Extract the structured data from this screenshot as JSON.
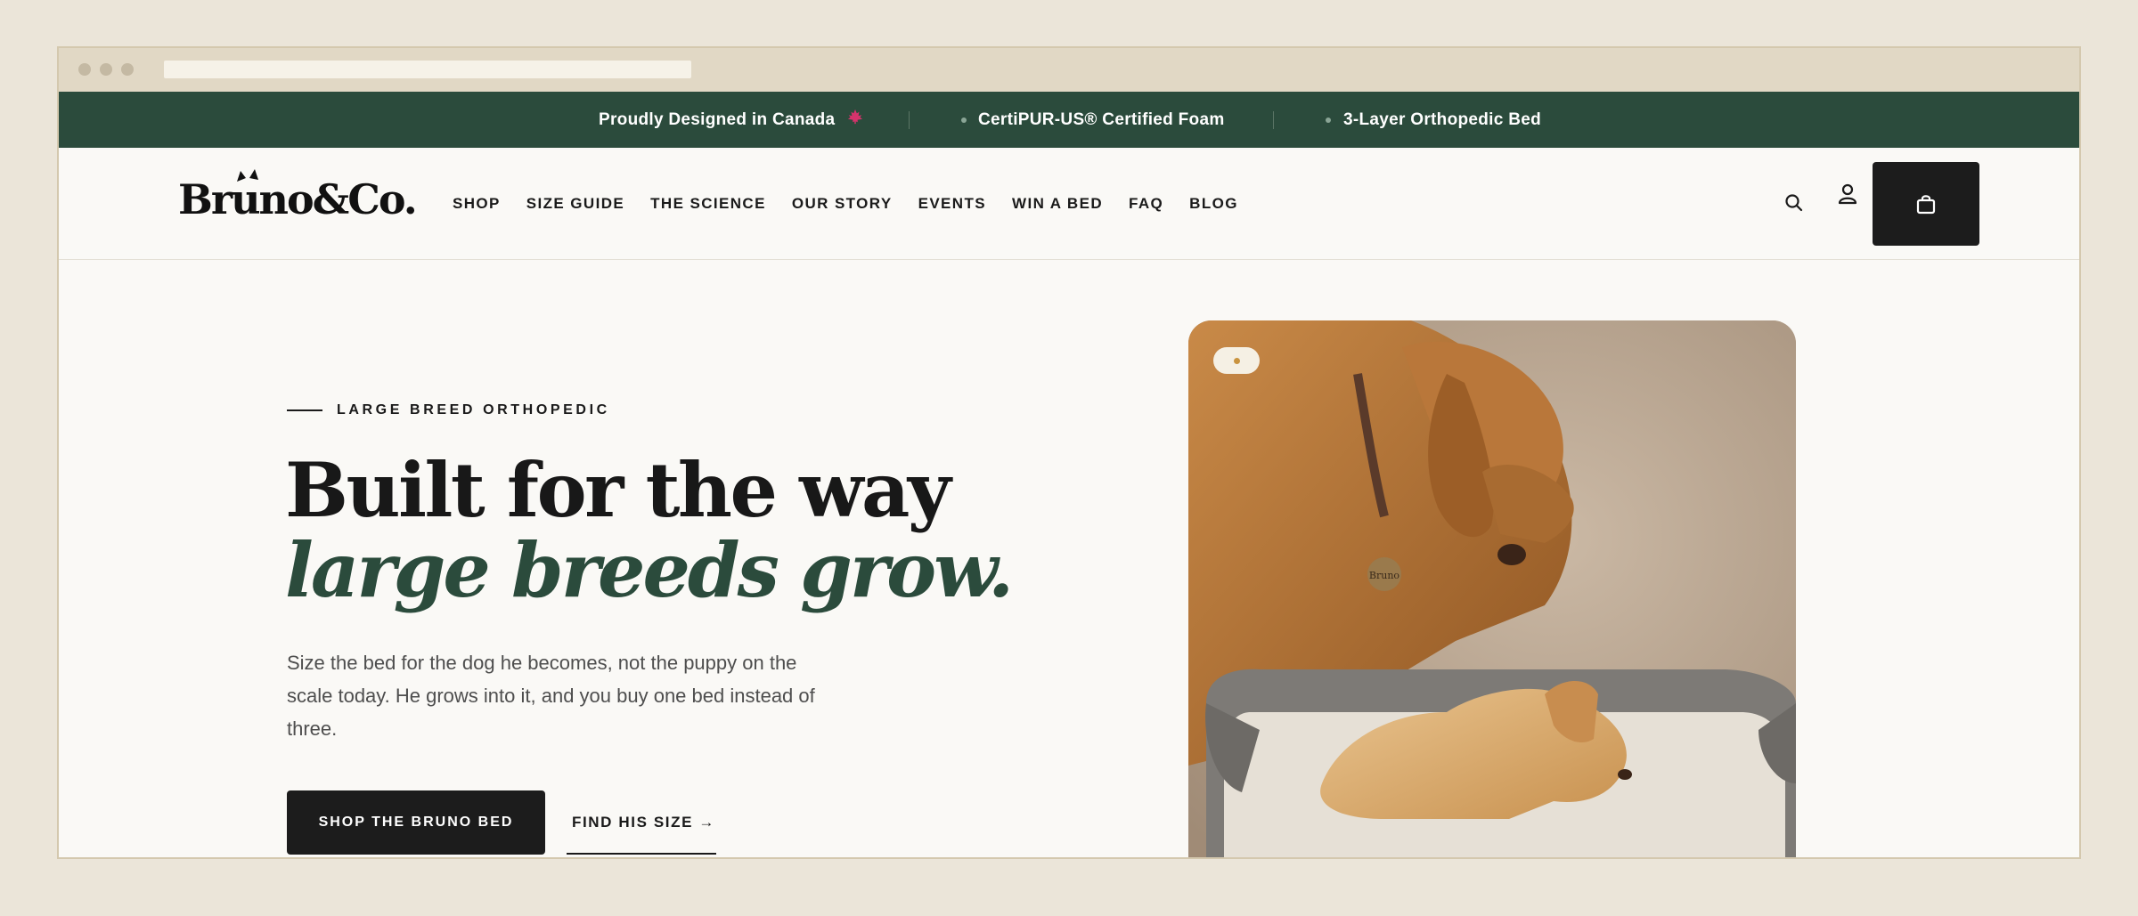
{
  "announcement": {
    "item1": "Proudly Designed in Canada",
    "item2": "CertiPUR-US® Certified Foam",
    "item3": "3-Layer Orthopedic Bed"
  },
  "header": {
    "logo": "Bruno&Co.",
    "nav": [
      "SHOP",
      "SIZE GUIDE",
      "THE SCIENCE",
      "OUR STORY",
      "EVENTS",
      "WIN A BED",
      "FAQ",
      "BLOG"
    ]
  },
  "hero": {
    "eyebrow": "LARGE BREED ORTHOPEDIC",
    "headline_line1": "Built for the way",
    "headline_line2": "large breeds grow.",
    "lead": "Size the bed for the dog he becomes, not the puppy on the scale today. He grows into it, and you buy one bed instead of three.",
    "cta_primary": "SHOP THE BRUNO BED",
    "cta_secondary": "FIND HIS SIZE →",
    "image_tag_text": "Bruno"
  },
  "colors": {
    "brand_green": "#2b4b3c",
    "dark": "#1c1c1c",
    "background": "#faf9f6",
    "maple_leaf": "#d6336c"
  },
  "icons": [
    "maple-leaf-icon",
    "search-icon",
    "account-icon",
    "shopping-bag-icon"
  ]
}
